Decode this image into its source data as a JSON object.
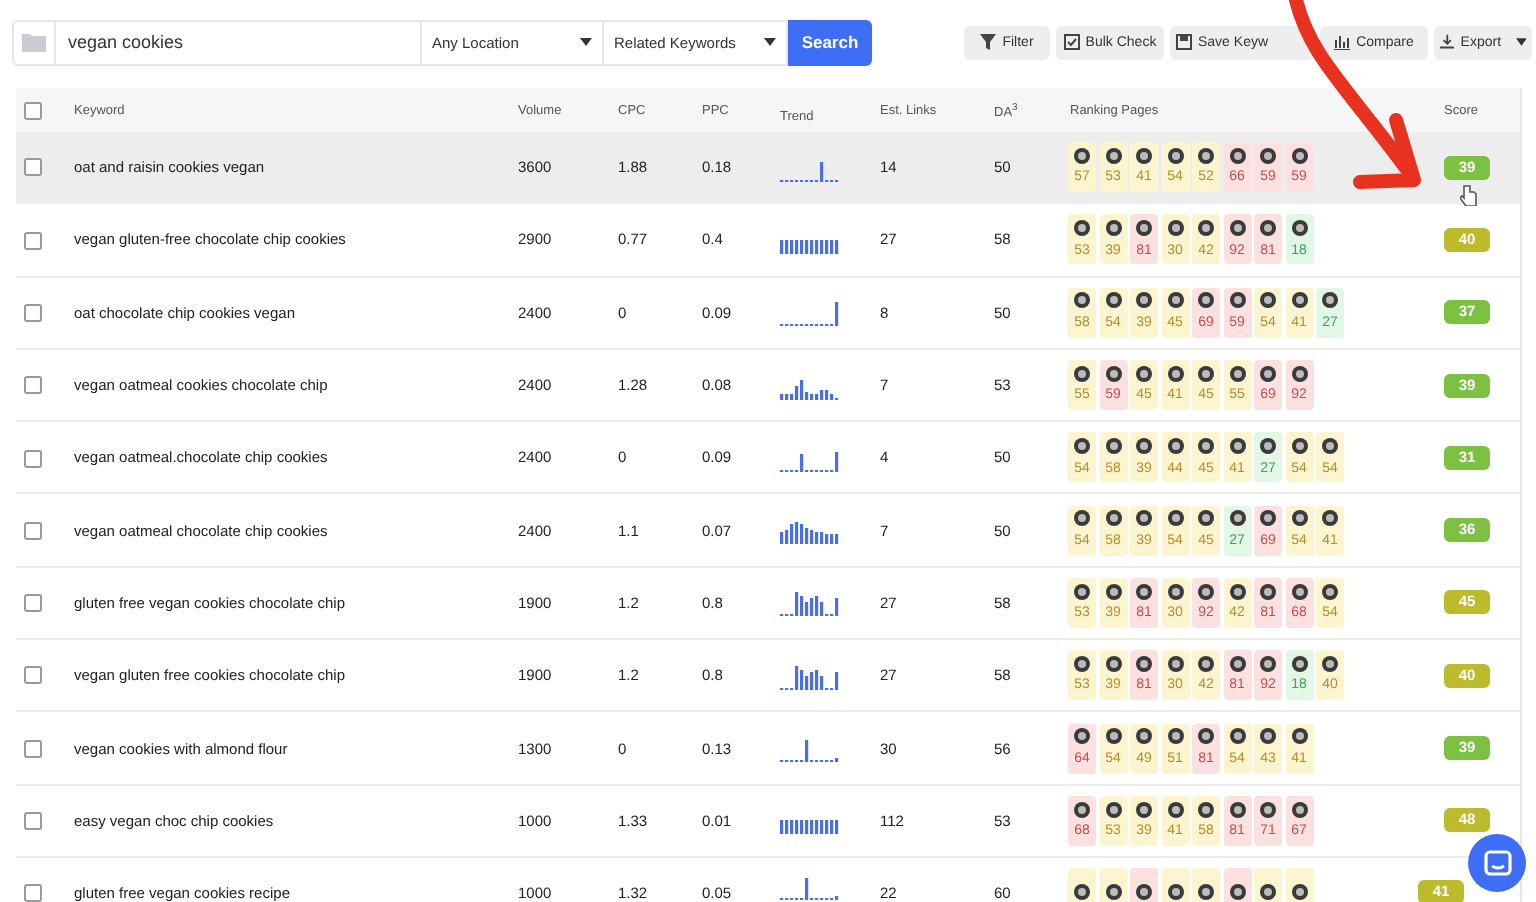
{
  "toolbar": {
    "search": {
      "value": "vegan cookies"
    },
    "location": "Any Location",
    "mode": "Related Keywords",
    "search_button": "Search",
    "actions": [
      {
        "label": "Filter",
        "kind": "filter"
      },
      {
        "label": "Bulk Check",
        "kind": "check"
      },
      {
        "label": "Save Keyw",
        "kind": "save"
      },
      {
        "label": "Compare",
        "kind": "chart"
      },
      {
        "label": "Export",
        "kind": "export"
      }
    ]
  },
  "table": {
    "select_all": {
      "checked": false
    },
    "columns": [
      "Keyword",
      "Volume",
      "CPC",
      "PPC",
      "Trend",
      "Est. Links",
      "DA$^{3}$",
      "Ranking Pages",
      "Score"
    ],
    "rows": [
      {
        "checked": false,
        "highlighted": true,
        "keyword": "oat and raisin cookies vegan",
        "volume": "3600",
        "cpc": "1.88",
        "ppc": "0.18",
        "trend": {
          "kind": "spike"
        },
        "links": "14",
        "da": "50",
        "pages": [
          {
            "score": "57",
            "color": "#fdf5cf"
          },
          {
            "score": "53",
            "color": "#fdf5cf"
          },
          {
            "score": "41",
            "color": "#fdf5cf"
          },
          {
            "score": "54",
            "color": "#fdf5cf"
          },
          {
            "score": "52",
            "color": "#fdf5cf"
          },
          {
            "score": "66",
            "color": "#fde1e1"
          },
          {
            "score": "59",
            "color": "#fde1e1"
          },
          {
            "score": "59",
            "color": "#fde1e1"
          }
        ],
        "score": {
          "value": "39",
          "color": "#7cc142"
        }
      },
      {
        "checked": false,
        "highlighted": false,
        "keyword": "vegan gluten-free chocolate chip cookies",
        "volume": "2900",
        "cpc": "0.77",
        "ppc": "0.4",
        "trend": {
          "kind": "flat"
        },
        "links": "27",
        "da": "58",
        "pages": [
          {
            "score": "53",
            "color": "#fdf5cf"
          },
          {
            "score": "39",
            "color": "#fdf5cf"
          },
          {
            "score": "81",
            "color": "#fde1e1"
          },
          {
            "score": "30",
            "color": "#fdf5cf"
          },
          {
            "score": "42",
            "color": "#fdf5cf"
          },
          {
            "score": "92",
            "color": "#fde1e1"
          },
          {
            "score": "81",
            "color": "#fde1e1"
          },
          {
            "score": "18",
            "color": "#e3f7e7"
          }
        ],
        "score": {
          "value": "40",
          "color": "#bdbb2c"
        }
      },
      {
        "checked": false,
        "highlighted": false,
        "keyword": "oat chocolate chip cookies vegan",
        "volume": "2400",
        "cpc": "0",
        "ppc": "0.09",
        "trend": {
          "kind": "rise"
        },
        "links": "8",
        "da": "50",
        "pages": [
          {
            "score": "58",
            "color": "#fdf5cf"
          },
          {
            "score": "54",
            "color": "#fdf5cf"
          },
          {
            "score": "39",
            "color": "#fdf5cf"
          },
          {
            "score": "45",
            "color": "#fdf5cf"
          },
          {
            "score": "69",
            "color": "#fde1e1"
          },
          {
            "score": "59",
            "color": "#fde1e1"
          },
          {
            "score": "54",
            "color": "#fdf5cf"
          },
          {
            "score": "41",
            "color": "#fdf5cf"
          },
          {
            "score": "27",
            "color": "#e3f7e7"
          }
        ],
        "score": {
          "value": "37",
          "color": "#7cc142"
        }
      },
      {
        "checked": false,
        "highlighted": false,
        "keyword": "vegan oatmeal cookies chocolate chip",
        "volume": "2400",
        "cpc": "1.28",
        "ppc": "0.08",
        "trend": {
          "kind": "varied"
        },
        "links": "7",
        "da": "53",
        "pages": [
          {
            "score": "55",
            "color": "#fdf5cf"
          },
          {
            "score": "59",
            "color": "#fde1e1"
          },
          {
            "score": "45",
            "color": "#fdf5cf"
          },
          {
            "score": "41",
            "color": "#fdf5cf"
          },
          {
            "score": "45",
            "color": "#fdf5cf"
          },
          {
            "score": "55",
            "color": "#fdf5cf"
          },
          {
            "score": "69",
            "color": "#fde1e1"
          },
          {
            "score": "92",
            "color": "#fde1e1"
          }
        ],
        "score": {
          "value": "39",
          "color": "#7cc142"
        }
      },
      {
        "checked": false,
        "highlighted": false,
        "keyword": "vegan oatmeal.chocolate chip cookies",
        "volume": "2400",
        "cpc": "0",
        "ppc": "0.09",
        "trend": {
          "kind": "twin"
        },
        "links": "4",
        "da": "50",
        "pages": [
          {
            "score": "54",
            "color": "#fdf5cf"
          },
          {
            "score": "58",
            "color": "#fdf5cf"
          },
          {
            "score": "39",
            "color": "#fdf5cf"
          },
          {
            "score": "44",
            "color": "#fdf5cf"
          },
          {
            "score": "45",
            "color": "#fdf5cf"
          },
          {
            "score": "41",
            "color": "#fdf5cf"
          },
          {
            "score": "27",
            "color": "#e3f7e7"
          },
          {
            "score": "54",
            "color": "#fdf5cf"
          },
          {
            "score": "54",
            "color": "#fdf5cf"
          }
        ],
        "score": {
          "value": "31",
          "color": "#7cc142"
        }
      },
      {
        "checked": false,
        "highlighted": false,
        "keyword": "vegan oatmeal chocolate chip cookies",
        "volume": "2400",
        "cpc": "1.1",
        "ppc": "0.07",
        "trend": {
          "kind": "hump"
        },
        "links": "7",
        "da": "50",
        "pages": [
          {
            "score": "54",
            "color": "#fdf5cf"
          },
          {
            "score": "58",
            "color": "#fdf5cf"
          },
          {
            "score": "39",
            "color": "#fdf5cf"
          },
          {
            "score": "54",
            "color": "#fdf5cf"
          },
          {
            "score": "45",
            "color": "#fdf5cf"
          },
          {
            "score": "27",
            "color": "#e3f7e7"
          },
          {
            "score": "69",
            "color": "#fde1e1"
          },
          {
            "score": "54",
            "color": "#fdf5cf"
          },
          {
            "score": "41",
            "color": "#fdf5cf"
          }
        ],
        "score": {
          "value": "36",
          "color": "#7cc142"
        }
      },
      {
        "checked": false,
        "highlighted": false,
        "keyword": "gluten free vegan cookies chocolate chip",
        "volume": "1900",
        "cpc": "1.2",
        "ppc": "0.8",
        "trend": {
          "kind": "cluster"
        },
        "links": "27",
        "da": "58",
        "pages": [
          {
            "score": "53",
            "color": "#fdf5cf"
          },
          {
            "score": "39",
            "color": "#fdf5cf"
          },
          {
            "score": "81",
            "color": "#fde1e1"
          },
          {
            "score": "30",
            "color": "#fdf5cf"
          },
          {
            "score": "92",
            "color": "#fde1e1"
          },
          {
            "score": "42",
            "color": "#fdf5cf"
          },
          {
            "score": "81",
            "color": "#fde1e1"
          },
          {
            "score": "68",
            "color": "#fde1e1"
          },
          {
            "score": "54",
            "color": "#fdf5cf"
          }
        ],
        "score": {
          "value": "45",
          "color": "#bdbb2c"
        }
      },
      {
        "checked": false,
        "highlighted": false,
        "keyword": "vegan gluten free cookies chocolate chip",
        "volume": "1900",
        "cpc": "1.2",
        "ppc": "0.8",
        "trend": {
          "kind": "cluster"
        },
        "links": "27",
        "da": "58",
        "pages": [
          {
            "score": "53",
            "color": "#fdf5cf"
          },
          {
            "score": "39",
            "color": "#fdf5cf"
          },
          {
            "score": "81",
            "color": "#fde1e1"
          },
          {
            "score": "30",
            "color": "#fdf5cf"
          },
          {
            "score": "42",
            "color": "#fdf5cf"
          },
          {
            "score": "81",
            "color": "#fde1e1"
          },
          {
            "score": "92",
            "color": "#fde1e1"
          },
          {
            "score": "18",
            "color": "#e3f7e7"
          },
          {
            "score": "40",
            "color": "#fdf5cf"
          }
        ],
        "score": {
          "value": "40",
          "color": "#bdbb2c"
        }
      },
      {
        "checked": false,
        "highlighted": false,
        "keyword": "vegan cookies with almond flour",
        "volume": "1300",
        "cpc": "0",
        "ppc": "0.13",
        "trend": {
          "kind": "early"
        },
        "links": "30",
        "da": "56",
        "pages": [
          {
            "score": "64",
            "color": "#fde1e1"
          },
          {
            "score": "54",
            "color": "#fdf5cf"
          },
          {
            "score": "49",
            "color": "#fdf5cf"
          },
          {
            "score": "51",
            "color": "#fdf5cf"
          },
          {
            "score": "81",
            "color": "#fde1e1"
          },
          {
            "score": "54",
            "color": "#fdf5cf"
          },
          {
            "score": "43",
            "color": "#fdf5cf"
          },
          {
            "score": "41",
            "color": "#fdf5cf"
          }
        ],
        "score": {
          "value": "39",
          "color": "#7cc142"
        }
      },
      {
        "checked": false,
        "highlighted": false,
        "keyword": "easy vegan choc chip cookies",
        "volume": "1000",
        "cpc": "1.33",
        "ppc": "0.01",
        "trend": {
          "kind": "flat"
        },
        "links": "112",
        "da": "53",
        "pages": [
          {
            "score": "68",
            "color": "#fde1e1"
          },
          {
            "score": "53",
            "color": "#fdf5cf"
          },
          {
            "score": "39",
            "color": "#fdf5cf"
          },
          {
            "score": "41",
            "color": "#fdf5cf"
          },
          {
            "score": "58",
            "color": "#fdf5cf"
          },
          {
            "score": "81",
            "color": "#fde1e1"
          },
          {
            "score": "71",
            "color": "#fde1e1"
          },
          {
            "score": "67",
            "color": "#fde1e1"
          }
        ],
        "score": {
          "value": "48",
          "color": "#bdbb2c"
        }
      },
      {
        "checked": false,
        "highlighted": false,
        "keyword": "gluten free vegan cookies recipe",
        "volume": "1000",
        "cpc": "1.32",
        "ppc": "0.05",
        "trend": {
          "kind": "early"
        },
        "links": "22",
        "da": "60",
        "pages": [
          {
            "color": "#fdf5cf"
          },
          {
            "color": "#fdf5cf"
          },
          {
            "color": "#fde1e1"
          },
          {
            "color": "#fdf5cf"
          },
          {
            "color": "#fdf5cf"
          },
          {
            "color": "#fde1e1"
          },
          {
            "color": "#fdf5cf"
          },
          {
            "color": "#fdf5cf"
          }
        ],
        "score": {
          "value": "41",
          "color": "#bdbb2c"
        }
      }
    ]
  }
}
